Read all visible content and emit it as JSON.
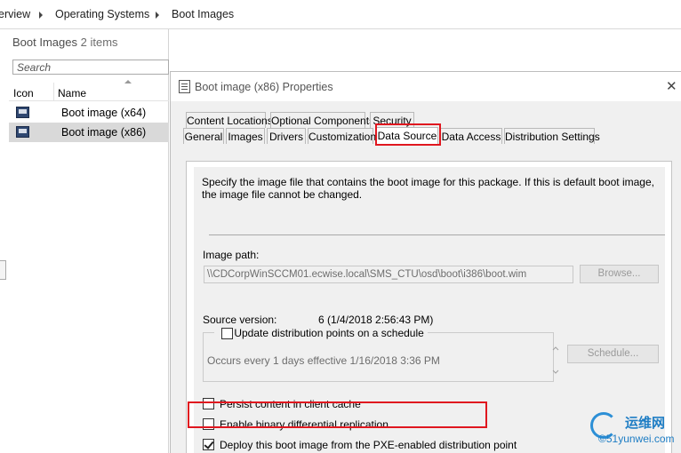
{
  "breadcrumb": {
    "items": [
      "erview",
      "Operating Systems",
      "Boot Images"
    ]
  },
  "list": {
    "title": "Boot Images",
    "count": "2 items",
    "search_placeholder": "Search",
    "columns": {
      "icon": "Icon",
      "name": "Name"
    },
    "rows": [
      {
        "name": "Boot image (x64)"
      },
      {
        "name": "Boot image (x86)"
      }
    ]
  },
  "dialog": {
    "title": "Boot image (x86) Properties",
    "close": "✕",
    "tabs_top": [
      "Content Locations",
      "Optional Components",
      "Security"
    ],
    "tabs_bottom": [
      "General",
      "Images",
      "Drivers",
      "Customization",
      "Data Source",
      "Data Access",
      "Distribution Settings"
    ],
    "active_tab": "Data Source",
    "description": "Specify the image file that contains the boot image for this package. If this is default boot image, the image file cannot be changed.",
    "image_path_label": "Image path:",
    "image_path_value": "\\\\CDCorpWinSCCM01.ecwise.local\\SMS_CTU\\osd\\boot\\i386\\boot.wim",
    "browse_button": "Browse...",
    "source_version_label": "Source version:",
    "source_version_value": "6 (1/4/2018 2:56:43 PM)",
    "update_dp_label": "Update distribution points on a schedule",
    "update_dp_checked": false,
    "schedule_text": "Occurs every 1 days effective 1/16/2018 3:36 PM",
    "schedule_button": "Schedule...",
    "persist_label": "Persist content in client cache",
    "persist_checked": false,
    "binary_diff_label": "Enable binary differential replication",
    "binary_diff_checked": false,
    "deploy_pxe_label": "Deploy this boot image from the PXE-enabled distribution point",
    "deploy_pxe_checked": true
  },
  "watermark": {
    "line1": "运维网",
    "line2": "©51yunwei.com"
  },
  "colors": {
    "highlight": "#e0171f",
    "dialog_bg": "#f0f0f0",
    "selected_row": "#d9d9d9"
  }
}
